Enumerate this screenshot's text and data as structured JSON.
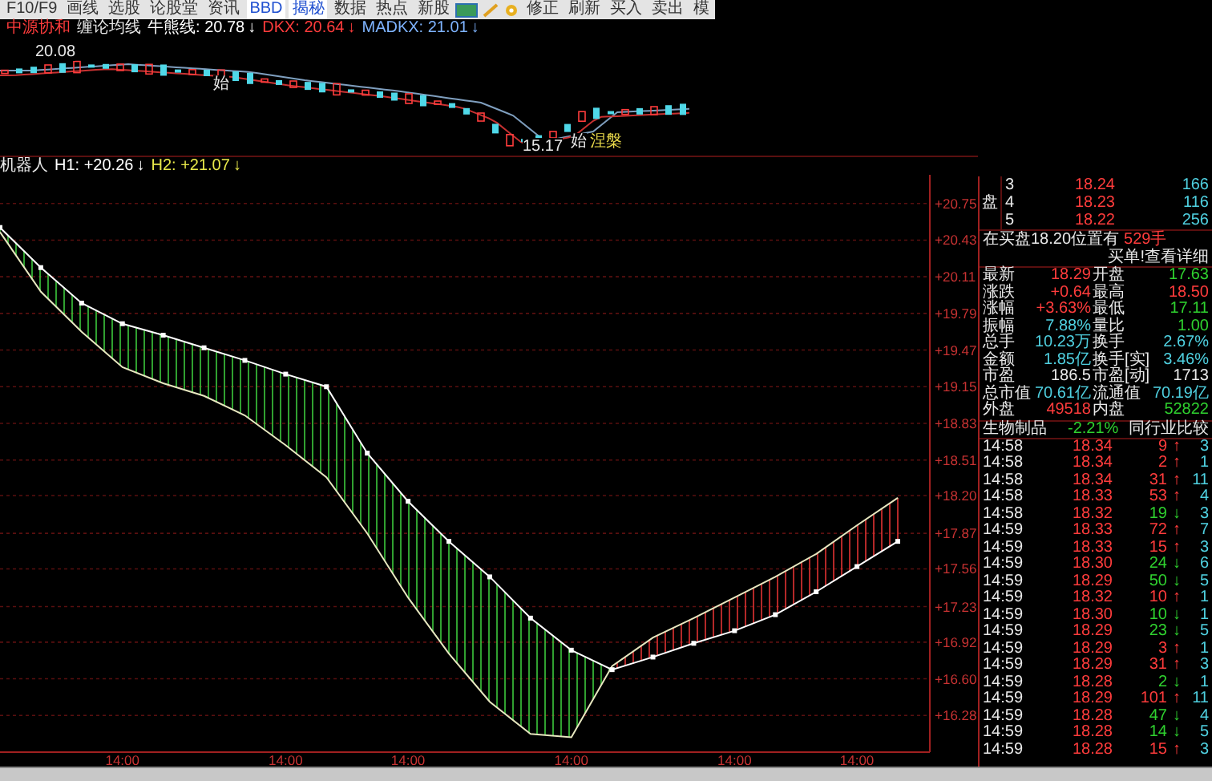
{
  "toolbar": {
    "left_buttons": [
      {
        "label": "F10/F9",
        "highlighted": false
      },
      {
        "label": "画线",
        "highlighted": false
      },
      {
        "label": "选股",
        "highlighted": false
      },
      {
        "label": "论股堂",
        "highlighted": false
      },
      {
        "label": "资讯",
        "highlighted": false
      },
      {
        "label": "BBD",
        "highlighted": true
      },
      {
        "label": "揭秘",
        "highlighted": true
      },
      {
        "label": "数据",
        "highlighted": false
      },
      {
        "label": "热点",
        "highlighted": false
      },
      {
        "label": "新股",
        "highlighted": false
      }
    ],
    "right_buttons": [
      {
        "label": "修正"
      },
      {
        "label": "刷新"
      },
      {
        "label": "买入"
      },
      {
        "label": "卖出"
      },
      {
        "label": "模"
      }
    ]
  },
  "top_chart": {
    "stock": "中源协和",
    "indicator": "缠论均线",
    "values": [
      {
        "name": "牛熊线:",
        "value": "20.78",
        "arrow": "↓",
        "color": "#ffffff"
      },
      {
        "name": "DKX:",
        "value": "20.64",
        "arrow": "↓",
        "color": "#ff3c3c"
      },
      {
        "name": "MADKX:",
        "value": "21.01",
        "arrow": "↓",
        "color": "#7fb4ff"
      }
    ],
    "annotations": [
      "20.08",
      "始",
      "15.17",
      "始",
      "涅槃"
    ]
  },
  "indicator": {
    "name": "机器人",
    "lines": [
      {
        "name": "H1:",
        "value": "+20.26",
        "arrow": "↓",
        "color": "#ffffff"
      },
      {
        "name": "H2:",
        "value": "+21.07",
        "arrow": "↓",
        "color": "#e8e84a"
      }
    ]
  },
  "main_chart": {
    "chart_data": {
      "type": "line",
      "categories": [
        null,
        null,
        null,
        "14:00",
        null,
        null,
        null,
        "14:00",
        null,
        null,
        "14:00",
        null,
        null,
        null,
        "14:00",
        null,
        null,
        null,
        "14:00",
        null,
        null,
        "14:00",
        null
      ],
      "grid": true,
      "series": [
        {
          "color": "#ffffff",
          "marker": true,
          "values": [
            20.54,
            20.19,
            19.88,
            19.7,
            19.6,
            19.49,
            19.38,
            19.26,
            19.15,
            18.57,
            18.15,
            17.8,
            17.49,
            17.13,
            16.85,
            16.68,
            16.79,
            16.91,
            17.02,
            17.16,
            17.36,
            17.58,
            17.8
          ]
        },
        {
          "color": "#e8e8c0",
          "values": [
            20.5,
            19.98,
            19.63,
            19.32,
            19.18,
            19.07,
            18.9,
            18.64,
            18.36,
            17.87,
            17.31,
            16.82,
            16.4,
            16.12,
            16.09,
            16.71,
            16.96,
            17.13,
            17.31,
            17.49,
            17.69,
            17.94,
            18.18
          ]
        }
      ],
      "ylim": [
        15.96,
        21.0
      ],
      "yticks": [
        {
          "value": 20.75,
          "label": "+20.75"
        },
        {
          "value": 20.43,
          "label": "+20.43"
        },
        {
          "value": 20.11,
          "label": "+20.11"
        },
        {
          "value": 19.79,
          "label": "+19.79"
        },
        {
          "value": 19.47,
          "label": "+19.47"
        },
        {
          "value": 19.15,
          "label": "+19.15"
        },
        {
          "value": 18.83,
          "label": "+18.83"
        },
        {
          "value": 18.51,
          "label": "+18.51"
        },
        {
          "value": 18.2,
          "label": "+18.20"
        },
        {
          "value": 17.87,
          "label": "+17.87"
        },
        {
          "value": 17.56,
          "label": "+17.56"
        },
        {
          "value": 17.23,
          "label": "+17.23"
        },
        {
          "value": 16.92,
          "label": "+16.92"
        },
        {
          "value": 16.6,
          "label": "+16.60"
        },
        {
          "value": 16.28,
          "label": "+16.28"
        }
      ]
    }
  },
  "order_book": {
    "side_label": "盘",
    "rows": [
      {
        "level": "3",
        "price": "18.24",
        "volume": "166"
      },
      {
        "level": "4",
        "price": "18.23",
        "volume": "116"
      },
      {
        "level": "5",
        "price": "18.22",
        "volume": "256"
      }
    ]
  },
  "notice": {
    "text": "在买盘18.20位置有",
    "amount": "529手",
    "link": "买单!查看详细"
  },
  "stats": [
    {
      "label": "最新",
      "value": "18.29",
      "color": "#ff3c3c"
    },
    {
      "label": "开盘",
      "value": "17.63",
      "color": "#2fd12f"
    },
    {
      "label": "涨跌",
      "value": "+0.64",
      "color": "#ff3c3c"
    },
    {
      "label": "最高",
      "value": "18.50",
      "color": "#ff3c3c"
    },
    {
      "label": "涨幅",
      "value": "+3.63%",
      "color": "#ff3c3c"
    },
    {
      "label": "最低",
      "value": "17.11",
      "color": "#2fd12f"
    },
    {
      "label": "振幅",
      "value": "7.88%",
      "color": "#4fd0e0"
    },
    {
      "label": "量比",
      "value": "1.00",
      "color": "#2fd12f"
    },
    {
      "label": "总手",
      "value": "10.23万",
      "color": "#4fd0e0"
    },
    {
      "label": "换手",
      "value": "2.67%",
      "color": "#4fd0e0"
    },
    {
      "label": "金额",
      "value": "1.85亿",
      "color": "#4fd0e0"
    },
    {
      "label": "换手[实]",
      "value": "3.46%",
      "color": "#4fd0e0"
    },
    {
      "label": "市盈",
      "value": "186.5",
      "color": "#e8e8e8"
    },
    {
      "label": "市盈[动]",
      "value": "1713",
      "color": "#e8e8e8"
    },
    {
      "label": "总市值",
      "value": "70.61亿",
      "color": "#4fd0e0"
    },
    {
      "label": "流通值",
      "value": "70.19亿",
      "color": "#4fd0e0"
    },
    {
      "label": "外盘",
      "value": "49518",
      "color": "#ff3c3c"
    },
    {
      "label": "内盘",
      "value": "52822",
      "color": "#2fd12f"
    }
  ],
  "sector": {
    "name": "生物制品",
    "change": "-2.21%",
    "link": "同行业比较"
  },
  "trades": [
    {
      "time": "14:58",
      "price": "18.34",
      "volume": "9",
      "arrow": "↑",
      "color": "#ff3c3c",
      "column_4": "3"
    },
    {
      "time": "14:58",
      "price": "18.34",
      "volume": "2",
      "arrow": "↑",
      "color": "#ff3c3c",
      "column_4": "1"
    },
    {
      "time": "14:58",
      "price": "18.34",
      "volume": "31",
      "arrow": "↑",
      "color": "#ff3c3c",
      "column_4": "11"
    },
    {
      "time": "14:58",
      "price": "18.33",
      "volume": "53",
      "arrow": "↑",
      "color": "#ff3c3c",
      "column_4": "4"
    },
    {
      "time": "14:58",
      "price": "18.32",
      "volume": "19",
      "arrow": "↓",
      "color": "#2fd12f",
      "column_4": "3"
    },
    {
      "time": "14:59",
      "price": "18.33",
      "volume": "72",
      "arrow": "↑",
      "color": "#ff3c3c",
      "column_4": "7"
    },
    {
      "time": "14:59",
      "price": "18.33",
      "volume": "15",
      "arrow": "↑",
      "color": "#ff3c3c",
      "column_4": "3"
    },
    {
      "time": "14:59",
      "price": "18.30",
      "volume": "24",
      "arrow": "↓",
      "color": "#2fd12f",
      "column_4": "6"
    },
    {
      "time": "14:59",
      "price": "18.29",
      "volume": "50",
      "arrow": "↓",
      "color": "#2fd12f",
      "column_4": "5"
    },
    {
      "time": "14:59",
      "price": "18.32",
      "volume": "10",
      "arrow": "↑",
      "color": "#ff3c3c",
      "column_4": "1"
    },
    {
      "time": "14:59",
      "price": "18.30",
      "volume": "10",
      "arrow": "↓",
      "color": "#2fd12f",
      "column_4": "1"
    },
    {
      "time": "14:59",
      "price": "18.29",
      "volume": "23",
      "arrow": "↓",
      "color": "#2fd12f",
      "column_4": "5"
    },
    {
      "time": "14:59",
      "price": "18.29",
      "volume": "3",
      "arrow": "↑",
      "color": "#ff3c3c",
      "column_4": "1"
    },
    {
      "time": "14:59",
      "price": "18.29",
      "volume": "31",
      "arrow": "↑",
      "color": "#ff3c3c",
      "column_4": "3"
    },
    {
      "time": "14:59",
      "price": "18.28",
      "volume": "2",
      "arrow": "↓",
      "color": "#2fd12f",
      "column_4": "1"
    },
    {
      "time": "14:59",
      "price": "18.29",
      "volume": "101",
      "arrow": "↑",
      "color": "#ff3c3c",
      "column_4": "11"
    },
    {
      "time": "14:59",
      "price": "18.28",
      "volume": "47",
      "arrow": "↓",
      "color": "#2fd12f",
      "column_4": "4"
    },
    {
      "time": "14:59",
      "price": "18.28",
      "volume": "14",
      "arrow": "↓",
      "color": "#2fd12f",
      "column_4": "5"
    },
    {
      "time": "14:59",
      "price": "18.28",
      "volume": "15",
      "arrow": "↑",
      "color": "#ff3c3c",
      "column_4": "3"
    }
  ]
}
